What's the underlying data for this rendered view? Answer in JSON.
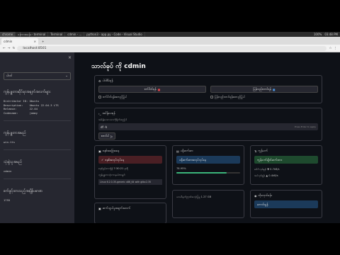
{
  "os": {
    "tabs": [
      "chrome",
      "ဝန်ကားစခန်း - terminal",
      "Terminal",
      "cdmin - ...",
      "python3 - app.py - Code - Visual Studio"
    ],
    "clock": "03:48 PM",
    "status": "100%"
  },
  "browser": {
    "tabs": [
      {
        "label": "cdmin",
        "active": true
      }
    ],
    "url": "localhost:8501"
  },
  "sidebar": {
    "select_value": "ပါဝင်",
    "system_info_heading": "ကွန်ပျူတာဆိုင်ရာအချက်အလက်များ",
    "system_info": "Distributor ID: Ubuntu\nDescription:    Ubuntu 22.04.3 LTS\nRelease:        22.04\nCodename:       jammy",
    "host_heading": "ကွန်ပျူတာအမည်",
    "host_value": "win-tts",
    "user_heading": "သုံးစွဲသူအမည်",
    "user_value": "cdmin",
    "uptime_heading": "စက်ဖွင့်ထားသည့်အချိန်ပမာဏ",
    "uptime_value": "1755"
  },
  "main": {
    "title": "သာလ်ခုပ် ကို cdmin",
    "power": {
      "title": "ပါဝါစီမံရန်",
      "shutdown_label": "စက်ပိတ်ရန်",
      "restart_label": "ပြန်လည်စတင်ရန်",
      "shutdown_confirm": "စက်ပိတ်ရန်အတည်ပြုပါ",
      "restart_confirm": "ပြန်လည်စတင်ရန်အတည်ပြုပါ"
    },
    "command": {
      "title": "အမိန့်ပေးရန်",
      "prompt": "အမိန့်ပေးစာသားကိုရိုက်ထည့်ပါ",
      "value": "df -h",
      "hint": "Press Enter to apply",
      "run_label": "စတင်ပါ"
    },
    "cards": {
      "os_title": "စနစ်အခြေအနေ",
      "os_status": "စနစ်အလုပ်လုပ်နေ",
      "os_uptime_label": "စနစ်ဖွင့်ထားချိန်",
      "os_uptime_value": "7:30:21 နာရီ",
      "kernel_label": "ကွန်ပျူတာသုံးကာနယ်ဗားရှင်း",
      "kernel_value": "Linux 6.2.0-35-generic x86_64 with glibc2.35",
      "cpu_title": "ပရိုဆက်ဆာ",
      "cpu_status": "ပရိုဆက်ဆာအလုပ်လုပ်နေ",
      "cpu_percent_text": "78.95%",
      "cpu_fraction": 0.79,
      "net_title": "ကွန်ယက်",
      "net_status": "ကွန်ယက်ချိတ်ဆက်ထား",
      "net_down_label": "ဒေါင်းလုဒ်နှုန်း",
      "net_down_value": "0.7kB/s",
      "net_up_label": "အပ်လုဒ်နှုန်း",
      "net_up_value": "0.4kB/s",
      "mem_title": "မှတ်ဉာဏ်",
      "mem_label": "ယာယီမှတ်ဉာဏ်အသုံးပြုမှု",
      "mem_value": "1.27 GB",
      "disk_title": "သိုလှောင်ခန်း",
      "disk_status": "ကောင်းမွန်",
      "extra_title": "ဆက်သွယ်မှုအချက်အလက်"
    }
  },
  "colors": {
    "accent_red": "#e0434b",
    "accent_blue": "#4a8fd8",
    "green_bg": "#1e4a2e",
    "blue_bg": "#1b3a5a",
    "red_bg": "#4a1f24"
  }
}
